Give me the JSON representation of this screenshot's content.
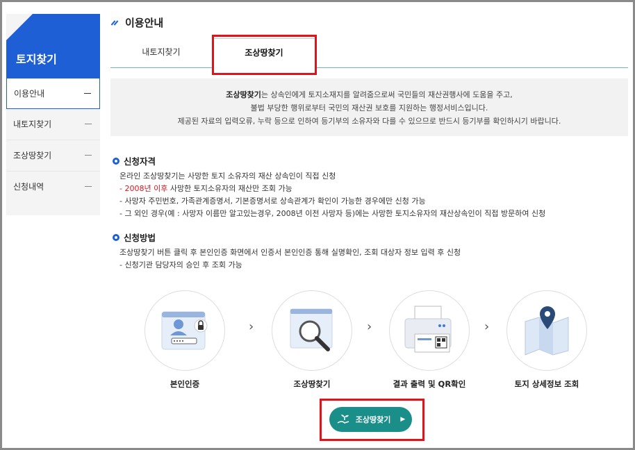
{
  "sidebar": {
    "title": "토지찾기",
    "items": [
      {
        "label": "이용안내"
      },
      {
        "label": "내토지찾기"
      },
      {
        "label": "조상땅찾기"
      },
      {
        "label": "신청내역"
      }
    ]
  },
  "header": {
    "title": "이용안내"
  },
  "tabs": [
    {
      "label": "내토지찾기"
    },
    {
      "label": "조상땅찾기"
    }
  ],
  "info": {
    "bold": "조상땅찾기",
    "line1_rest": "는 상속인에게 토지소재지를 알려줌으로써 국민들의 재산권행사에 도움을 주고,",
    "line2": "불법 부당한 행위로부터 국민의 재산권 보호를 지원하는 행정서비스입니다.",
    "line3": "제공된 자료의 입력오류, 누락 등으로 인하여 등기부의 소유자와 다를 수 있으므로 반드시 등기부를 확인하시기 바랍니다."
  },
  "qualification": {
    "title": "신청자격",
    "line1": "온라인 조상땅찾기는 사망한 토지 소유자의 재산 상속인이 직접 신청",
    "line2_prefix": "- ",
    "line2_red": "2008년 이후",
    "line2_rest": " 사망한 토지소유자의 재산만 조회 가능",
    "line3": "- 사망자 주민번호, 가족관계증명서, 기본증명서로 상속관계가 확인이 가능한 경우에만 신청 가능",
    "line4": "- 그 외인 경우(예 : 사망자 이름만 알고있는경우, 2008년 이전 사망자 등)에는 사망한 토지소유자의 재산상속인이 직접 방문하여 신청"
  },
  "method": {
    "title": "신청방법",
    "line1": "조상땅찾기 버튼 클릭 후 본인인증 화면에서 인증서 본인인증 통해 실명확인, 조회 대상자 정보 입력 후 신청",
    "line2": "- 신청기관 담당자의 승인 후 조회 가능"
  },
  "steps": [
    {
      "label": "본인인증",
      "icon": "id-card-lock-icon"
    },
    {
      "label": "조상땅찾기",
      "icon": "magnifier-icon"
    },
    {
      "label": "결과 출력 및 QR확인",
      "icon": "printer-qr-icon"
    },
    {
      "label": "토지 상세정보 조회",
      "icon": "map-pin-icon"
    }
  ],
  "cta": {
    "label": "조상땅찾기"
  },
  "colors": {
    "primary": "#1f5fd6",
    "teal": "#1a8f8a",
    "highlight": "#e0121a"
  }
}
